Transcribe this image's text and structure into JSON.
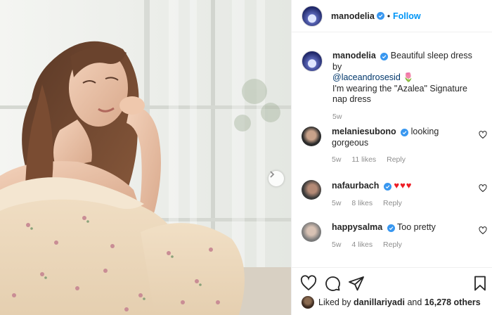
{
  "post": {
    "username": "manodelia",
    "follow_label": "Follow",
    "separator": "•"
  },
  "caption": {
    "username": "manodelia",
    "text_1": "Beautiful sleep dress by",
    "mention": "@laceandrosesid",
    "emoji": "🌷",
    "text_2": "I'm wearing the \"Azalea\" Signature nap dress",
    "time": "5w"
  },
  "comments": [
    {
      "username": "melaniesubono",
      "text": "looking gorgeous",
      "time": "5w",
      "likes": "11 likes",
      "reply": "Reply",
      "avatar_color": "#2b2b2b"
    },
    {
      "username": "nafaurbach",
      "text": "♥♥♥",
      "time": "5w",
      "likes": "8 likes",
      "reply": "Reply",
      "avatar_color": "#3a3a3a"
    },
    {
      "username": "happysalma",
      "text": "Too pretty",
      "time": "5w",
      "likes": "4 likes",
      "reply": "Reply",
      "avatar_color": "#7a7a7a"
    }
  ],
  "likes_line": {
    "prefix": "Liked by",
    "user": "danillariyadi",
    "and": "and",
    "others": "16,278 others"
  },
  "icons": [
    "heart-icon",
    "comment-icon",
    "share-icon",
    "save-icon",
    "verified-icon",
    "next-arrow-icon"
  ],
  "colors": {
    "link": "#0095f6",
    "mention": "#00376b",
    "meta": "#8e8e8e",
    "verified": "#3897f0",
    "hearts": "#ed1c24"
  }
}
